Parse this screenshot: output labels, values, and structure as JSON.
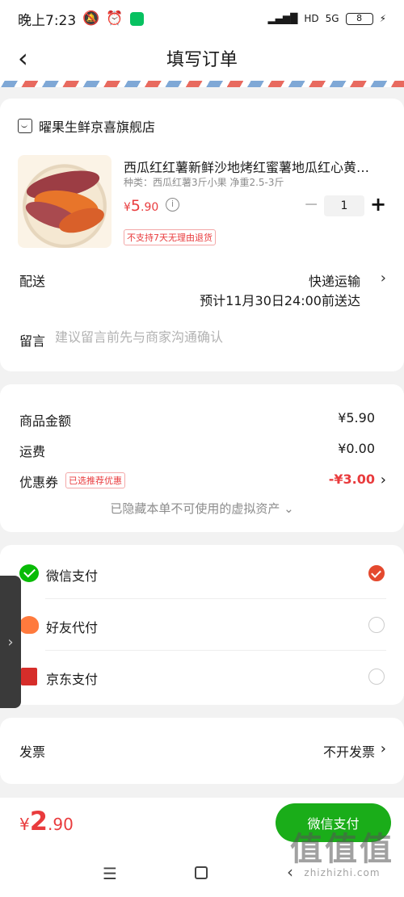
{
  "status_bar": {
    "time": "晚上7:23",
    "network": "5G",
    "hd": "HD",
    "battery": "8"
  },
  "header": {
    "title": "填写订单"
  },
  "shop": {
    "name": "曜果生鲜京喜旗舰店"
  },
  "product": {
    "title": "西瓜红红薯新鲜沙地烤红蜜薯地瓜红心黄心番薯",
    "spec": "种类：西瓜红薯3斤小果 净重2.5-3斤",
    "price_symbol": "¥",
    "price_main": "5",
    "price_decimal": ".90",
    "quantity": "1",
    "return_policy": "不支持7天无理由退货"
  },
  "shipping": {
    "label": "配送",
    "method": "快递运输",
    "eta": "预计11月30日24:00前送达"
  },
  "message": {
    "label": "留言",
    "placeholder": "建议留言前先与商家沟通确认"
  },
  "summary": {
    "goods_label": "商品金额",
    "goods_value": "¥5.90",
    "freight_label": "运费",
    "freight_value": "¥0.00",
    "coupon_label": "优惠券",
    "coupon_tag": "已选推荐优惠",
    "coupon_value": "-¥3.00",
    "hidden_assets": "已隐藏本单不可使用的虚拟资产 ⌄"
  },
  "payment_methods": [
    {
      "label": "微信支付",
      "icon": "wechat-pay-icon",
      "selected": true
    },
    {
      "label": "好友代付",
      "icon": "friend-pay-icon",
      "selected": false
    },
    {
      "label": "京东支付",
      "icon": "jd-pay-icon",
      "selected": false
    }
  ],
  "invoice": {
    "label": "发票",
    "value": "不开发票"
  },
  "footer": {
    "total_symbol": "¥",
    "total_main": "2",
    "total_decimal": ".90",
    "pay_button": "微信支付"
  },
  "watermark": {
    "text_big": "值值值",
    "text_small": "zhizhizhi.com"
  },
  "colors": {
    "accent_red": "#e93b3d",
    "wechat_green": "#1aad19",
    "radio_selected": "#e4492e"
  }
}
